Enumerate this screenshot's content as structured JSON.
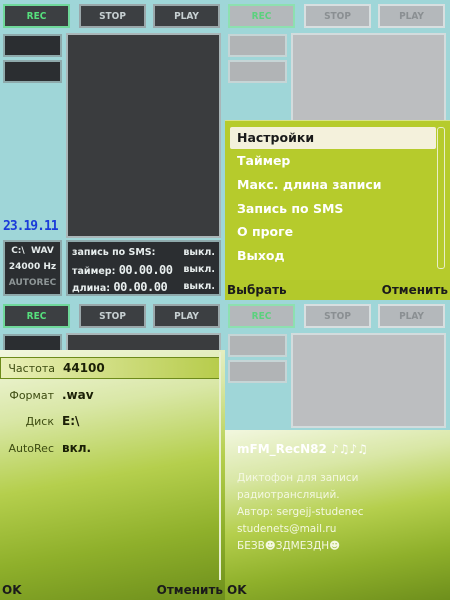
{
  "app": {
    "rec_label": "REC",
    "stop_label": "STOP",
    "play_label": "PLAY",
    "clock": "23.19.11",
    "drive": "C:\\",
    "format": "WAV",
    "rate": "24000 Hz",
    "autorec": "AUTOREC",
    "status": {
      "sms_label": "запись по SMS:",
      "sms_value": "выкл.",
      "timer_label": "таймер:",
      "timer_time": "00.00.00",
      "timer_value": "выкл.",
      "length_label": "длина:",
      "length_time": "00.00.00",
      "length_value": "выкл."
    }
  },
  "menu": {
    "items": [
      "Настройки",
      "Таймер",
      "Макс. длина записи",
      "Запись по SMS",
      "О проге",
      "Выход"
    ],
    "selected_index": 0,
    "left_soft": "Выбрать",
    "right_soft": "Отменить"
  },
  "settings": {
    "rows": [
      {
        "label": "Частота",
        "value": "44100"
      },
      {
        "label": "Формат",
        "value": ".wav"
      },
      {
        "label": "Диск",
        "value": "E:\\"
      },
      {
        "label": "AutoRec",
        "value": "вкл."
      }
    ],
    "left_soft": "OK",
    "right_soft": "Отменить"
  },
  "about": {
    "title": "mFM_RecN82 ♪♫♪♫",
    "line1": "Диктофон для записи",
    "line2": "радиотрансляций.",
    "line3": "Автор: sergejj-studenec",
    "line4": "studenets@mail.ru",
    "line5": "БЕЗВ☻ЗДМЕЗДН☻",
    "left_soft": "OK"
  },
  "colors": {
    "clock": "#1a3bd9",
    "rec_green": "#56e07d",
    "menu_bg": "#b6cb2c"
  }
}
